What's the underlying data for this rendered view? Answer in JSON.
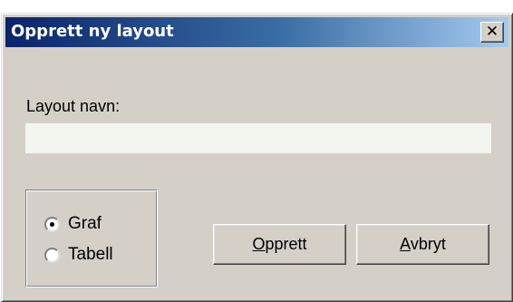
{
  "dialog": {
    "title": "Opprett ny layout",
    "close_glyph": "✕"
  },
  "form": {
    "name_label": "Layout navn:",
    "name_value": "",
    "name_placeholder": ""
  },
  "view_type": {
    "options": [
      {
        "label": "Graf",
        "selected": true
      },
      {
        "label": "Tabell",
        "selected": false
      }
    ]
  },
  "buttons": {
    "create": {
      "mnemonic": "O",
      "rest": "pprett"
    },
    "cancel": {
      "mnemonic": "A",
      "rest": "vbryt"
    }
  },
  "icons": {
    "close": "close-icon"
  },
  "colors": {
    "titlebar_start": "#0a246a",
    "titlebar_end": "#a6caf0",
    "dialog_bg": "#d4d0c8",
    "input_bg": "#f3f6ef"
  }
}
